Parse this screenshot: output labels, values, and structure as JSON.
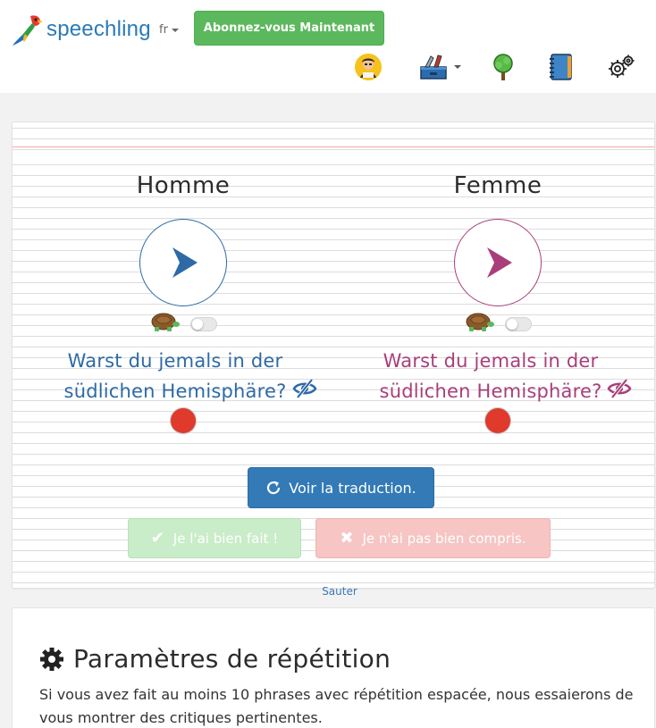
{
  "header": {
    "logo_text": "speechling",
    "language": "fr",
    "subscribe_label": "Abonnez-vous Maintenant",
    "nav_icons": [
      "student-avatar-icon",
      "toolbox-icon",
      "tree-icon",
      "notebook-icon",
      "gear-icon"
    ]
  },
  "exercise": {
    "male": {
      "heading": "Homme",
      "sentence": "Warst du jemals in der südlichen Hemisphäre?",
      "color": "#2d6aa6"
    },
    "female": {
      "heading": "Femme",
      "sentence": "Warst du jemals in der südlichen Hemisphäre?",
      "color": "#a83f7a"
    },
    "translate_label": "Voir la traduction.",
    "correct_label": "Je l'ai bien fait !",
    "wrong_label": "Je n'ai pas bien compris.",
    "skip_label": "Sauter"
  },
  "settings": {
    "title": "Paramètres de répétition",
    "description": "Si vous avez fait au moins 10 phrases avec répétition espacée, nous essaierons de vous montrer des critiques pertinentes."
  },
  "colors": {
    "brand_blue": "#2a7ab8",
    "subscribe_green": "#5cb85c",
    "primary_button": "#337ab7",
    "record_red": "#e03a2c"
  }
}
